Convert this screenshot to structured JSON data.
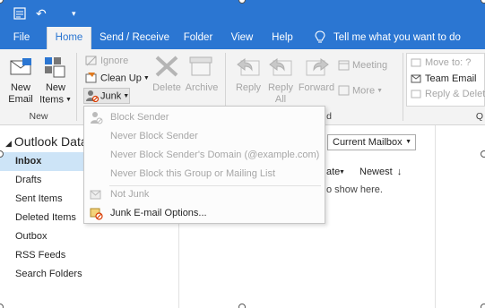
{
  "qat": {
    "undo_glyph": "↶",
    "more_glyph": "▾"
  },
  "tabs": [
    {
      "label": "File"
    },
    {
      "label": "Home"
    },
    {
      "label": "Send / Receive"
    },
    {
      "label": "Folder"
    },
    {
      "label": "View"
    },
    {
      "label": "Help"
    }
  ],
  "tellme": "Tell me what you want to do",
  "ribbon": {
    "new_email": "New\nEmail",
    "new_email_l1": "New",
    "new_email_l2": "Email",
    "new_items_l1": "New",
    "new_items_l2": "Items",
    "group_new": "New",
    "ignore": "Ignore",
    "clean_up": "Clean Up",
    "junk": "Junk",
    "delete": "Delete",
    "archive": "Archive",
    "reply": "Reply",
    "reply_all_l1": "Reply",
    "reply_all_l2": "All",
    "forward": "Forward",
    "meeting": "Meeting",
    "more": "More",
    "group_respond_partial": "d",
    "move_to": "Move to: ?",
    "team_email": "Team Email",
    "reply_delete": "Reply & Delete",
    "group_quick_partial": "Q"
  },
  "junk_menu": [
    {
      "label": "Block Sender",
      "enabled": false
    },
    {
      "label": "Never Block Sender",
      "enabled": false
    },
    {
      "label": "Never Block Sender's Domain (@example.com)",
      "enabled": false
    },
    {
      "label": "Never Block this Group or Mailing List",
      "enabled": false
    },
    {
      "label": "Not Junk",
      "enabled": false
    },
    {
      "label": "Junk E-mail Options...",
      "enabled": true
    }
  ],
  "folders": {
    "root": "Outlook Data",
    "items": [
      {
        "label": "Inbox",
        "selected": true
      },
      {
        "label": "Drafts"
      },
      {
        "label": "Sent Items"
      },
      {
        "label": "Deleted Items"
      },
      {
        "label": "Outbox"
      },
      {
        "label": "RSS Feeds"
      },
      {
        "label": "Search Folders"
      }
    ]
  },
  "mail": {
    "scope": "Current Mailbox",
    "sort_by": "ate",
    "sort_order": "Newest",
    "empty_message": "o show here."
  },
  "colors": {
    "titlebar": "#2b76d2",
    "ribbon": "#f3f3f3",
    "selected_folder": "#cde4f7",
    "disabled_text": "#a6a6a6"
  }
}
